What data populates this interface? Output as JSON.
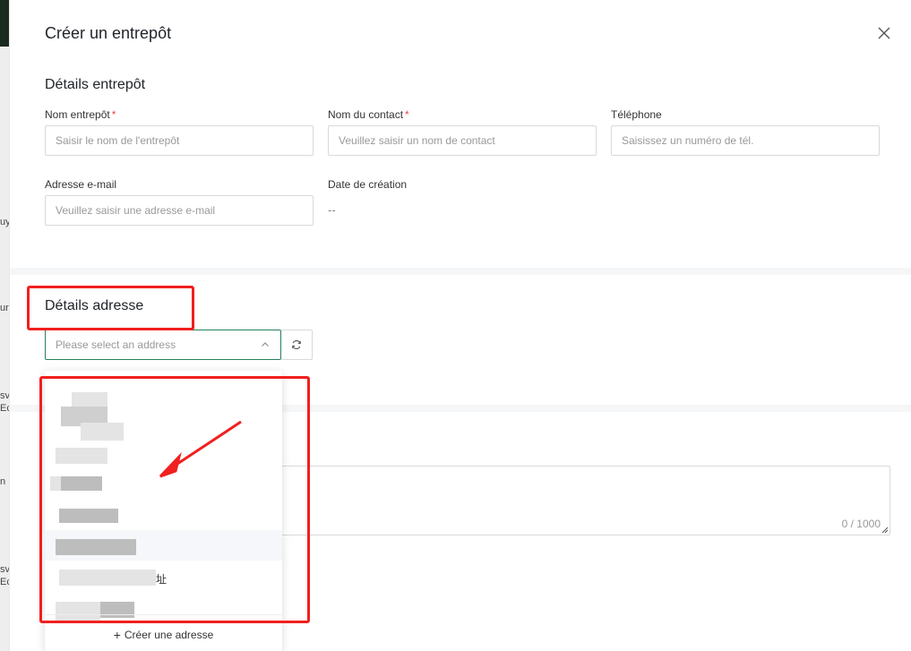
{
  "backdrop_fragments": [
    "uy",
    "ur",
    "sv",
    "Ec",
    "n",
    "sv",
    "Ec"
  ],
  "drawer": {
    "title": "Créer un entrepôt"
  },
  "warehouse_details": {
    "heading": "Détails entrepôt",
    "name_label": "Nom entrepôt",
    "name_placeholder": "Saisir le nom de l'entrepôt",
    "contact_label": "Nom du contact",
    "contact_placeholder": "Veuillez saisir un nom de contact",
    "phone_label": "Téléphone",
    "phone_placeholder": "Saisissez un numéro de tél.",
    "email_label": "Adresse e-mail",
    "email_placeholder": "Veuillez saisir une adresse e-mail",
    "created_label": "Date de création",
    "created_value": "--",
    "required_mark": "*"
  },
  "address_details": {
    "heading": "Détails adresse",
    "select_placeholder": "Please select an address",
    "dropdown_partial_text": "址",
    "create_address_label": "Créer une adresse",
    "create_icon": "+"
  },
  "notes": {
    "counter": "0 / 1000"
  },
  "colors": {
    "accent": "#27805b",
    "required": "#e5484d",
    "annotation": "#f0201e"
  }
}
